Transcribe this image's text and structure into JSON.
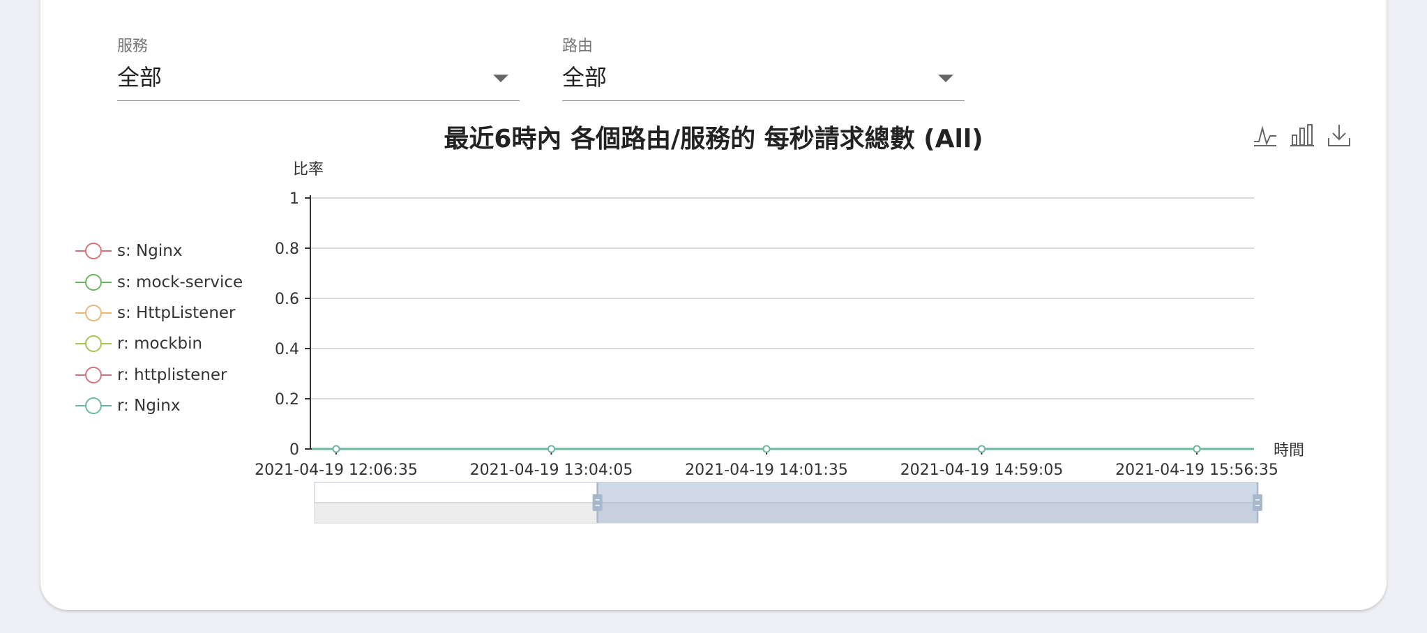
{
  "filters": {
    "service": {
      "label": "服務",
      "value": "全部"
    },
    "route": {
      "label": "路由",
      "value": "全部"
    }
  },
  "toolbox": [
    "line-chart-icon",
    "bar-chart-icon",
    "download-icon"
  ],
  "chart_data": {
    "type": "line",
    "title": "最近6時內 各個路由/服務的 每秒請求總數 (All)",
    "ylabel": "比率",
    "xlabel": "時間",
    "ylim": [
      0,
      1
    ],
    "y_ticks": [
      "0",
      "0.2",
      "0.4",
      "0.6",
      "0.8",
      "1"
    ],
    "y_tick_values": [
      0,
      0.2,
      0.4,
      0.6,
      0.8,
      1
    ],
    "grid": true,
    "legend_position": "left",
    "x": [
      "2021-04-19 12:06:35",
      "2021-04-19 13:04:05",
      "2021-04-19 14:01:35",
      "2021-04-19 14:59:05",
      "2021-04-19 15:56:35"
    ],
    "series": [
      {
        "name": "s: Nginx",
        "color": "#d9737a",
        "values": [
          0,
          0,
          0,
          0,
          0
        ]
      },
      {
        "name": "s: mock-service",
        "color": "#6cb563",
        "values": [
          0,
          0,
          0,
          0,
          0
        ]
      },
      {
        "name": "s: HttpListener",
        "color": "#e8b87c",
        "values": [
          0,
          0,
          0,
          0,
          0
        ]
      },
      {
        "name": "r: mockbin",
        "color": "#a8c34f",
        "values": [
          0,
          0,
          0,
          0,
          0
        ]
      },
      {
        "name": "r: httplistener",
        "color": "#d6717f",
        "values": [
          0,
          0,
          0,
          0,
          0
        ]
      },
      {
        "name": "r: Nginx",
        "color": "#6cb8a0",
        "values": [
          0,
          0,
          0,
          0,
          0
        ]
      }
    ],
    "zoom_range": [
      0.3,
      1
    ]
  }
}
